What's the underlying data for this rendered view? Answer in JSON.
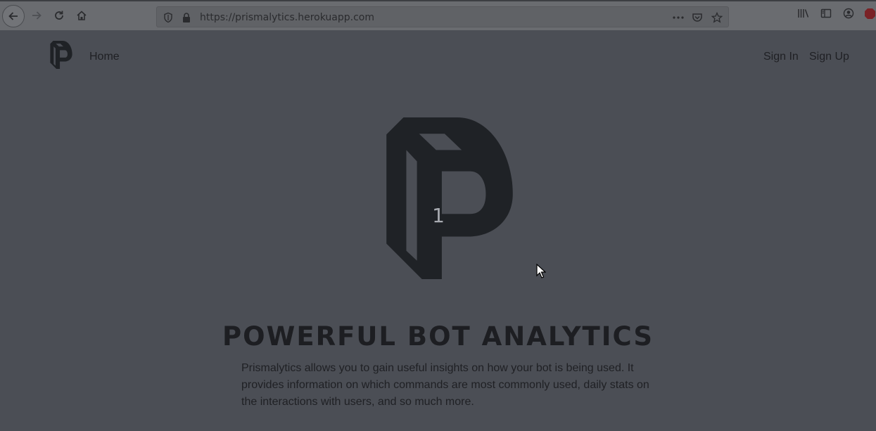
{
  "browser": {
    "url": "https://prismalytics.herokuapp.com",
    "icons": [
      "back-arrow-icon",
      "forward-arrow-icon",
      "reload-icon",
      "home-icon",
      "shield-icon",
      "lock-icon",
      "more-icon",
      "pocket-icon",
      "bookmark-star-icon",
      "library-icon",
      "sidebar-icon",
      "account-icon",
      "adblock-icon"
    ]
  },
  "nav": {
    "home_label": "Home",
    "sign_in_label": "Sign In",
    "sign_up_label": "Sign Up"
  },
  "hero": {
    "slide_number": "1",
    "title": "POWERFUL BOT ANALYTICS",
    "description": "Prismalytics allows you to gain useful insights on how your bot is being used. It provides information on which commands are most commonly used, daily stats on the interactions with users, and so much more."
  },
  "colors": {
    "page_background": "#4b4e55",
    "logo_color": "#1f2226",
    "text_color": "#1f2024"
  }
}
